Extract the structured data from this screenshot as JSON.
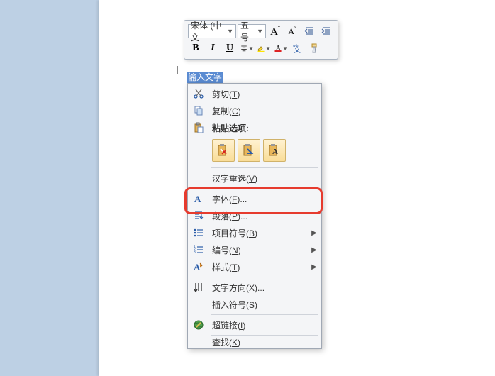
{
  "mini_toolbar": {
    "font_name": "宋体 (中文",
    "font_size": "五号",
    "grow_font": "A",
    "shrink_font": "A",
    "bold": "B",
    "italic": "I",
    "underline": "U"
  },
  "selection": {
    "text": "输入文字"
  },
  "context_menu": {
    "cut": {
      "label": "剪切",
      "key": "T"
    },
    "copy": {
      "label": "复制",
      "key": "C"
    },
    "paste_options": {
      "label": "粘贴选项:"
    },
    "reconvert": {
      "label": "汉字重选",
      "key": "V"
    },
    "font": {
      "label": "字体",
      "key": "F",
      "suffix": "..."
    },
    "paragraph": {
      "label": "段落",
      "key": "P",
      "suffix": "..."
    },
    "bullets": {
      "label": "项目符号",
      "key": "B"
    },
    "numbering": {
      "label": "编号",
      "key": "N"
    },
    "styles": {
      "label": "样式",
      "key": "T"
    },
    "text_direction": {
      "label": "文字方向",
      "key": "X",
      "suffix": "..."
    },
    "insert_symbol": {
      "label": "插入符号",
      "key": "S"
    },
    "hyperlink": {
      "label": "超链接",
      "key": "I"
    },
    "lookup": {
      "label": "查找",
      "key": "K"
    }
  }
}
